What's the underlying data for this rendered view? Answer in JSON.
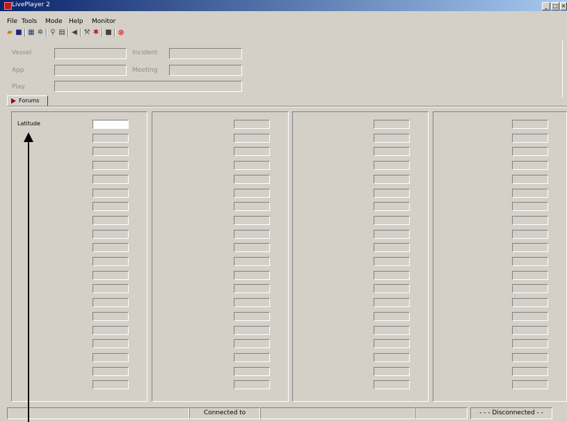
{
  "window": {
    "title": "LivePlayer 2"
  },
  "menu": [
    "File",
    "Tools",
    "Mode",
    "Help",
    "Monitor"
  ],
  "toolbar_icons": [
    "open-icon",
    "save-icon",
    "network-icon",
    "settings-icon",
    "connect-icon",
    "grid-icon",
    "speaker-icon",
    "tools-icon",
    "bug-icon",
    "stop-icon",
    "close-circle-icon"
  ],
  "form": {
    "left_labels": [
      "Vessel",
      "App",
      "Play"
    ],
    "right_labels": [
      "Incident",
      "Meeting"
    ]
  },
  "tabs": [
    {
      "label": "Forums"
    }
  ],
  "panels": [
    {
      "first_label": "Latitude"
    }
  ],
  "status": {
    "connected_label": "Connected to",
    "disconnected": "- - - Disconnected - -"
  }
}
